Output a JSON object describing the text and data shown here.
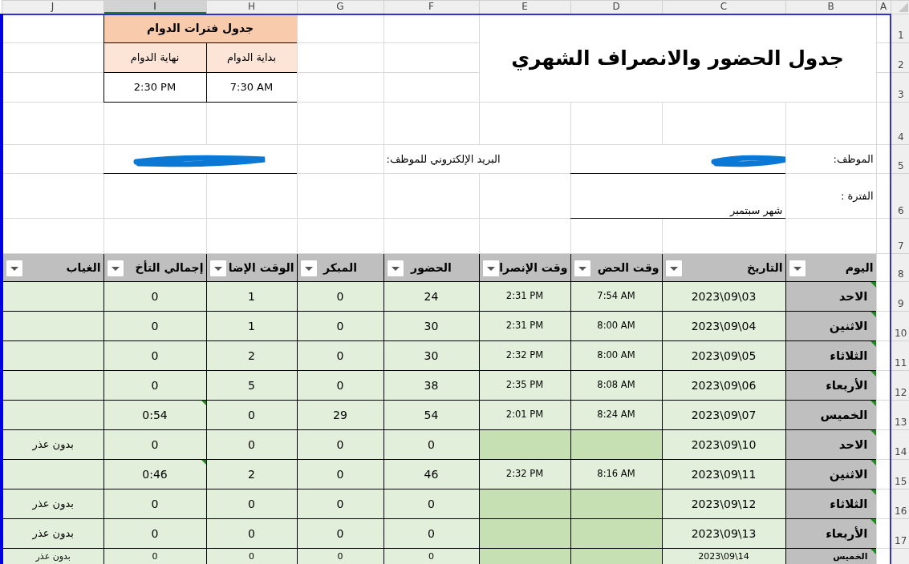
{
  "columns": [
    {
      "label": "A",
      "selected": false
    },
    {
      "label": "B",
      "selected": false
    },
    {
      "label": "C",
      "selected": false
    },
    {
      "label": "D",
      "selected": false
    },
    {
      "label": "E",
      "selected": false
    },
    {
      "label": "F",
      "selected": false
    },
    {
      "label": "G",
      "selected": false
    },
    {
      "label": "H",
      "selected": false
    },
    {
      "label": "I",
      "selected": true
    },
    {
      "label": "J",
      "selected": false
    }
  ],
  "row_numbers": [
    "1",
    "2",
    "3",
    "4",
    "5",
    "6",
    "7",
    "8",
    "9",
    "10",
    "11",
    "12",
    "13",
    "14",
    "15",
    "16",
    "17"
  ],
  "title": "جدول الحضور والانصراف الشهري",
  "shift_table": {
    "title": "جدول فترات الدوام",
    "start_label": "بداية الدوام",
    "end_label": "نهاية الدوام",
    "start_value": "7:30 AM",
    "end_value": "2:30 PM"
  },
  "employee": {
    "label": "الموظف:",
    "redacted": true
  },
  "email": {
    "label": "البريد الإلكتروني للموظف:",
    "redacted": true
  },
  "period": {
    "label": "الفترة :",
    "value": "شهر سبتمبر"
  },
  "headers": [
    "اليوم",
    "التاريخ",
    "وقت الحض",
    "وقت الإنصرا",
    "الحضور",
    "المبكر",
    "الوقت الإضا",
    "إجمالي التأخ",
    "الغياب"
  ],
  "rows": [
    {
      "day": "الاحد",
      "date": "2023\\09\\03",
      "in": "7:54 AM",
      "out": "2:31 PM",
      "late": "24",
      "early": "0",
      "overtime": "1",
      "total": "0",
      "missing": false,
      "flagged": false
    },
    {
      "day": "الاثنين",
      "date": "2023\\09\\04",
      "in": "8:00 AM",
      "out": "2:31 PM",
      "late": "30",
      "early": "0",
      "overtime": "1",
      "total": "0",
      "missing": false,
      "flagged": false
    },
    {
      "day": "الثلاثاء",
      "date": "2023\\09\\05",
      "in": "8:00 AM",
      "out": "2:32 PM",
      "late": "30",
      "early": "0",
      "overtime": "2",
      "total": "0",
      "missing": false,
      "flagged": false
    },
    {
      "day": "الأربعاء",
      "date": "2023\\09\\06",
      "in": "8:08 AM",
      "out": "2:35 PM",
      "late": "38",
      "early": "0",
      "overtime": "5",
      "total": "0",
      "missing": false,
      "flagged": false
    },
    {
      "day": "الخميس",
      "date": "2023\\09\\07",
      "in": "8:24 AM",
      "out": "2:01 PM",
      "late": "54",
      "early": "29",
      "overtime": "0",
      "total": "0:54",
      "missing": false,
      "flagged": true
    },
    {
      "day": "الاحد",
      "date": "2023\\09\\10",
      "late": "0",
      "early": "0",
      "overtime": "0",
      "total": "0",
      "absence": "بدون عذر",
      "missing": true,
      "flagged": false
    },
    {
      "day": "الاثنين",
      "date": "2023\\09\\11",
      "in": "8:16 AM",
      "out": "2:32 PM",
      "late": "46",
      "early": "0",
      "overtime": "2",
      "total": "0:46",
      "missing": false,
      "flagged": true
    },
    {
      "day": "الثلاثاء",
      "date": "2023\\09\\12",
      "late": "0",
      "early": "0",
      "overtime": "0",
      "total": "0",
      "absence": "بدون عذر",
      "missing": true,
      "flagged": false
    },
    {
      "day": "الأربعاء",
      "date": "2023\\09\\13",
      "late": "0",
      "early": "0",
      "overtime": "0",
      "total": "0",
      "absence": "بدون عذر",
      "missing": true,
      "flagged": false
    },
    {
      "day": "الخميس",
      "date": "2023\\09\\14",
      "late": "0",
      "early": "0",
      "overtime": "0",
      "total": "0",
      "absence": "بدون عذر",
      "missing": true,
      "flagged": false
    }
  ]
}
